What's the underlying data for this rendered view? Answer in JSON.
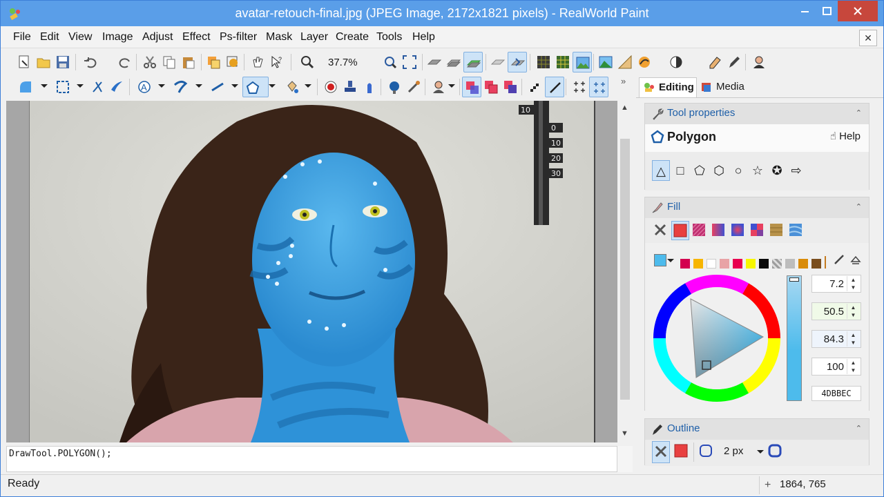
{
  "window": {
    "title": "avatar-retouch-final.jpg (JPEG Image, 2172x1821 pixels) - RealWorld Paint"
  },
  "menu": [
    "File",
    "Edit",
    "View",
    "Image",
    "Adjust",
    "Effect",
    "Ps-filter",
    "Mask",
    "Layer",
    "Create",
    "Tools",
    "Help"
  ],
  "toolbar": {
    "zoom": "37.7%"
  },
  "canvas": {
    "thermometer_labels": [
      "10",
      "0",
      "10",
      "20",
      "30"
    ]
  },
  "script": {
    "text": "DrawTool.POLYGON();"
  },
  "status": {
    "text": "Ready",
    "coords": "1864, 765"
  },
  "panel": {
    "tabs": {
      "editing": "Editing",
      "media": "Media"
    },
    "tool_properties": {
      "title": "Tool properties",
      "tool_name": "Polygon",
      "help": "Help",
      "shapes": [
        "triangle",
        "square",
        "pentagon",
        "hexagon",
        "circle",
        "star",
        "gear",
        "arrow"
      ],
      "selected_shape": "triangle"
    },
    "fill": {
      "title": "Fill",
      "swatches": [
        "#1ea4e8",
        "#d3004f",
        "#f7b500",
        "#ffffff",
        "#e8a3a6",
        "#e8004f",
        "#f7f700",
        "#0a0a0a",
        "#9d9d9d",
        "#bdbdbd",
        "#d98b08",
        "#7a4e1e"
      ],
      "h": "7.2",
      "s": "50.5",
      "v": "84.3",
      "a": "100",
      "hex": "4DBBEC",
      "current_color": "#4dbbec"
    },
    "outline": {
      "title": "Outline",
      "width": "2 px",
      "color": "#e84040"
    }
  }
}
